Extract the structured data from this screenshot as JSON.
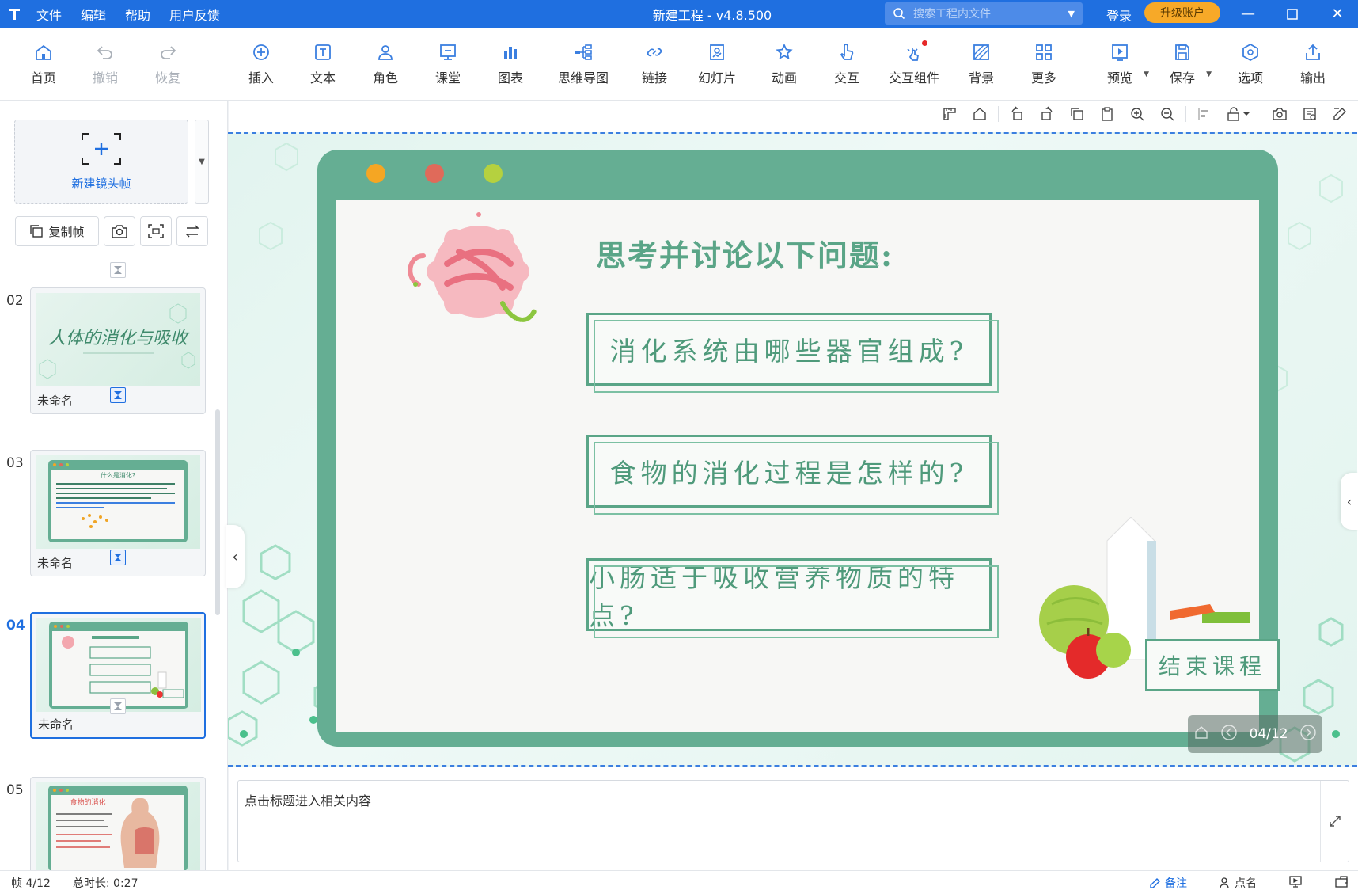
{
  "app": {
    "title": "新建工程 - v4.8.500",
    "menu": [
      "文件",
      "编辑",
      "帮助",
      "用户反馈"
    ],
    "search_placeholder": "搜索工程内文件",
    "login": "登录",
    "upgrade": "升级账户"
  },
  "toolbar": {
    "home": "首页",
    "undo": "撤销",
    "redo": "恢复",
    "insert": "插入",
    "text": "文本",
    "role": "角色",
    "classroom": "课堂",
    "chart": "图表",
    "mindmap": "思维导图",
    "link": "链接",
    "slides": "幻灯片",
    "animation": "动画",
    "interact": "交互",
    "interact_component": "交互组件",
    "background": "背景",
    "more": "更多",
    "preview": "预览",
    "save": "保存",
    "options": "选项",
    "export": "输出"
  },
  "left_panel": {
    "new_frame": "新建镜头帧",
    "copy_frame": "复制帧",
    "frames": [
      {
        "num": "02",
        "label": "未命名"
      },
      {
        "num": "03",
        "label": "未命名"
      },
      {
        "num": "04",
        "label": "未命名"
      },
      {
        "num": "05",
        "label": ""
      }
    ],
    "thumb02_title": "人体的消化与吸收",
    "thumb03_title": "什么是消化?",
    "thumb05_title": "食物的消化"
  },
  "slide": {
    "heading": "思考并讨论以下问题:",
    "questions": [
      "消化系统由哪些器官组成?",
      "食物的消化过程是怎样的?",
      "小肠适于吸收营养物质的特点?"
    ],
    "end_button": "结束课程",
    "page_indicator": "04/12",
    "colors": {
      "primary": "#65ae93",
      "dot1": "#f5a623",
      "dot2": "#e06a5a",
      "dot3": "#b5d13f"
    }
  },
  "notes": {
    "text": "点击标题进入相关内容"
  },
  "status": {
    "frame": "帧 4/12",
    "duration": "总时长: 0:27",
    "notes_btn": "备注",
    "rollcall": "点名"
  }
}
